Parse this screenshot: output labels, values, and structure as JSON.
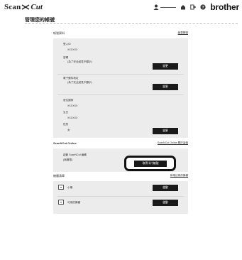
{
  "header": {
    "logo_scan": "Scan",
    "logo_cut": "Cut",
    "brand": "brother"
  },
  "page": {
    "title": "管理您的帳號"
  },
  "account": {
    "heading": "帳號資料",
    "link": "變更帳號",
    "login_id_label": "登入ID",
    "login_id_value": "XXXXXX",
    "password_label": "密碼",
    "password_value": "(為了安全起見不顯示)",
    "password_button": "變更",
    "email_label": "電子郵件地址",
    "email_value": "(為了安全起見不顯示)",
    "email_button": "變更",
    "region_label": "居住國家",
    "region_value": "XXXXXX",
    "birthday_label": "生日",
    "birthday_value": "XXXXXX",
    "gender_label": "性別",
    "gender_value": "女",
    "profile_button": "變更"
  },
  "online": {
    "heading": "ScanNCut Online",
    "link": "ScanNCut Online 關於這個",
    "status_label": "啟動 ScanNCut 編輯",
    "status_value": "(無權限)",
    "activate_button": "取得卡片編號"
  },
  "machines": {
    "heading": "機種清單",
    "link": "新增註冊的機種",
    "items": [
      {
        "name": "小機",
        "button": "啟動"
      },
      {
        "name": "可用的機種",
        "button": "啟動"
      }
    ]
  }
}
